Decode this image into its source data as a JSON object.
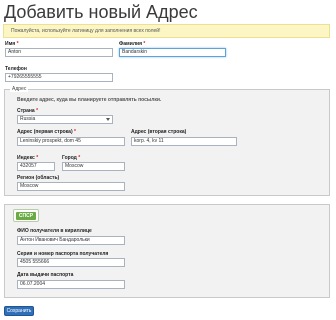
{
  "page": {
    "title": "Добавить новый Адрес"
  },
  "notice": {
    "text": "Пожалуйста, используйте латиницу для заполнения всех полей!"
  },
  "name": {
    "label": "Имя",
    "value": "Anton"
  },
  "surname": {
    "label": "Фамилия",
    "value": "Bandarskin"
  },
  "required_mark": "*",
  "phone": {
    "label": "Телефон",
    "value": "+79265555555"
  },
  "address": {
    "legend": "Адрес",
    "hint": "Введите адрес, куда вы планируете отправлять посылки.",
    "country": {
      "label": "Страна",
      "value": "Russia"
    },
    "line1": {
      "label": "Адрес (первая строка)",
      "value": "Leninskiy prospekt, dom 45"
    },
    "line2": {
      "label": "Адрес (вторая строка)",
      "value": "korp. 4, kv 11"
    },
    "zip": {
      "label": "Индекс",
      "value": "432057"
    },
    "city": {
      "label": "Город",
      "value": "Moscow"
    },
    "region": {
      "label": "Регион (область)",
      "value": "Moscow"
    }
  },
  "customs": {
    "logo_text": "СПСР",
    "fio": {
      "label": "ФИО получателя в кириллице",
      "value": "Антон Иванович Бандарольки"
    },
    "passport": {
      "label": "Серия и номер паспорта получателя",
      "value": "4505 555666"
    },
    "passport_date": {
      "label": "Дата выдачи паспорта",
      "value": "06.07.2004"
    }
  },
  "submit": {
    "label": "Сохранить"
  },
  "colors": {
    "notice_bg": "#fcf6c4",
    "button_bg": "#2f6fb7",
    "logo_green": "#6bab45",
    "required": "#d21c1c"
  }
}
